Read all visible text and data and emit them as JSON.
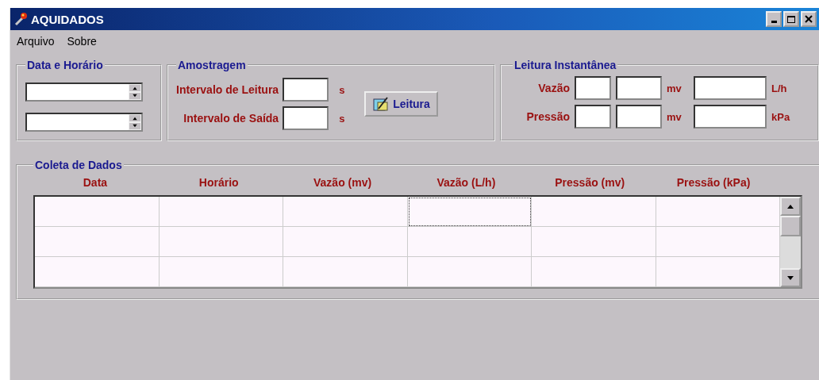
{
  "window": {
    "title": "AQUIDADOS"
  },
  "menu": [
    "Arquivo",
    "Sobre"
  ],
  "date_time": {
    "title": "Data e Horário",
    "fields": [
      {
        "kind": "spinner"
      },
      {
        "kind": "spinner"
      }
    ]
  },
  "sampling": {
    "title": "Amostragem",
    "rows": [
      {
        "label": "Intervalo de Leitura",
        "unit": "s"
      },
      {
        "label": "Intervalo de Saída",
        "unit": "s"
      }
    ],
    "button": "Leitura"
  },
  "instant": {
    "title": "Leitura Instantânea",
    "rows": [
      {
        "label": "Vazão",
        "unit_raw": "mv",
        "unit": "L/h"
      },
      {
        "label": "Pressão",
        "unit_raw": "mv",
        "unit": "kPa"
      }
    ]
  },
  "collection": {
    "title": "Coleta de Dados",
    "columns": [
      "Data",
      "Horário",
      "Vazão (mv)",
      "Vazão (L/h)",
      "Pressão (mv)",
      "Pressão (kPa)"
    ],
    "rows": [
      {
        "focused": [
          false,
          false,
          false,
          true,
          false,
          false
        ]
      },
      {
        "focused": [
          false,
          false,
          false,
          false,
          false,
          false
        ]
      },
      {
        "focused": [
          false,
          false,
          false,
          false,
          false,
          false
        ]
      }
    ]
  }
}
